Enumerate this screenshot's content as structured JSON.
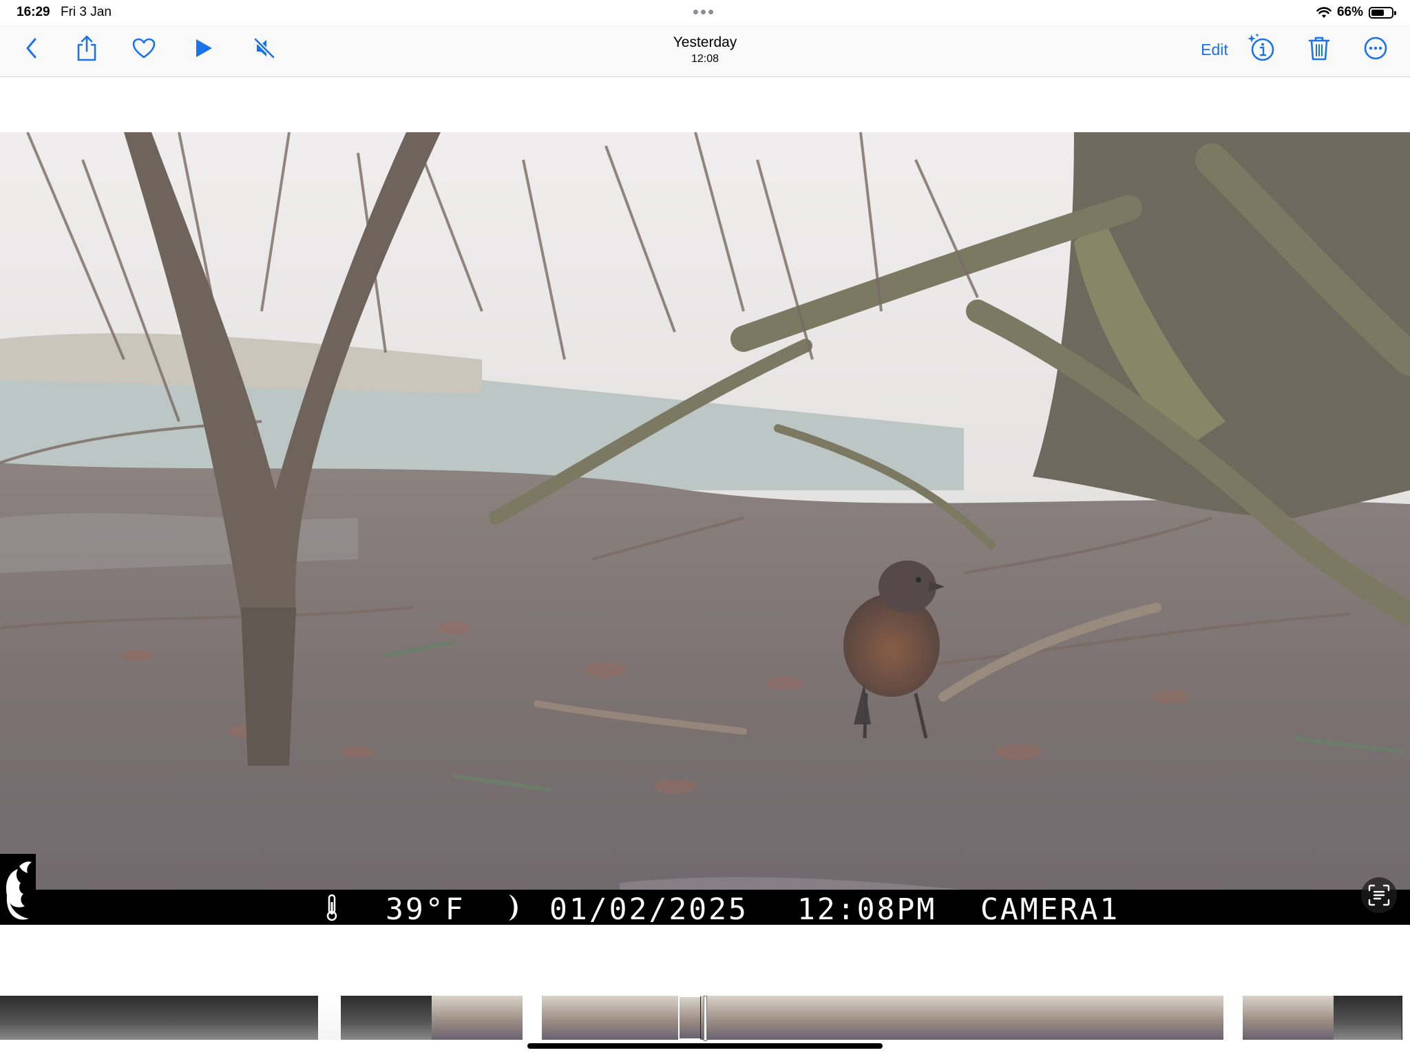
{
  "status_bar": {
    "time": "16:29",
    "date": "Fri 3 Jan",
    "battery": "66%",
    "battery_level": 0.66,
    "icons": [
      "wifi-icon",
      "battery-icon"
    ]
  },
  "toolbar": {
    "title": "Yesterday",
    "subtitle": "12:08",
    "edit_label": "Edit",
    "accent_color": "#1a73e8",
    "left_icons": [
      "back-chevron-icon",
      "share-icon",
      "heart-icon",
      "play-icon",
      "speaker-muted-icon"
    ],
    "right_icons": [
      "visual-lookup-info-icon",
      "trash-icon",
      "more-ellipsis-icon"
    ]
  },
  "photo": {
    "description_icon": "trail-camera-photo",
    "overlay": {
      "temperature": "39°F",
      "date": "01/02/2025",
      "time": "12:08PM",
      "camera": "CAMERA1",
      "icons": [
        "thermometer-icon",
        "moon-phase-icon",
        "buck-logo-icon"
      ]
    },
    "live_text_icon": "live-text-icon"
  },
  "filmstrip": {
    "thumbnails": [
      {
        "tone": "night"
      },
      {
        "tone": "night"
      },
      {
        "tone": "night"
      },
      {
        "tone": "night"
      },
      {
        "tone": "night"
      },
      {
        "tone": "night"
      },
      {
        "tone": "night"
      },
      {
        "tone": "night"
      },
      {
        "tone": "night"
      },
      {
        "tone": "night"
      },
      {
        "tone": "night"
      },
      {
        "tone": "night"
      },
      {
        "tone": "night"
      },
      {
        "tone": "night"
      },
      {
        "tone": "bright"
      },
      {
        "tone": "night"
      },
      {
        "tone": "night"
      },
      {
        "tone": "night"
      },
      {
        "tone": "night"
      },
      {
        "tone": "day"
      },
      {
        "tone": "day"
      },
      {
        "tone": "day"
      },
      {
        "tone": "day"
      },
      {
        "tone": "gap"
      },
      {
        "tone": "day"
      },
      {
        "tone": "day"
      },
      {
        "tone": "day"
      },
      {
        "tone": "day"
      },
      {
        "tone": "day"
      },
      {
        "tone": "day"
      },
      {
        "tone": "day"
      },
      {
        "tone": "day"
      },
      {
        "tone": "day"
      },
      {
        "tone": "day"
      },
      {
        "tone": "day"
      },
      {
        "tone": "day"
      },
      {
        "tone": "day"
      },
      {
        "tone": "day"
      },
      {
        "tone": "day"
      },
      {
        "tone": "day"
      },
      {
        "tone": "day"
      },
      {
        "tone": "day"
      },
      {
        "tone": "day"
      },
      {
        "tone": "day"
      },
      {
        "tone": "day"
      },
      {
        "tone": "day"
      },
      {
        "tone": "day"
      },
      {
        "tone": "day"
      },
      {
        "tone": "day"
      },
      {
        "tone": "day"
      },
      {
        "tone": "day"
      },
      {
        "tone": "day"
      },
      {
        "tone": "day"
      },
      {
        "tone": "day"
      },
      {
        "tone": "gap"
      },
      {
        "tone": "day"
      },
      {
        "tone": "day"
      },
      {
        "tone": "day"
      },
      {
        "tone": "day"
      },
      {
        "tone": "night"
      },
      {
        "tone": "night"
      },
      {
        "tone": "night"
      }
    ],
    "current_index": 30
  }
}
